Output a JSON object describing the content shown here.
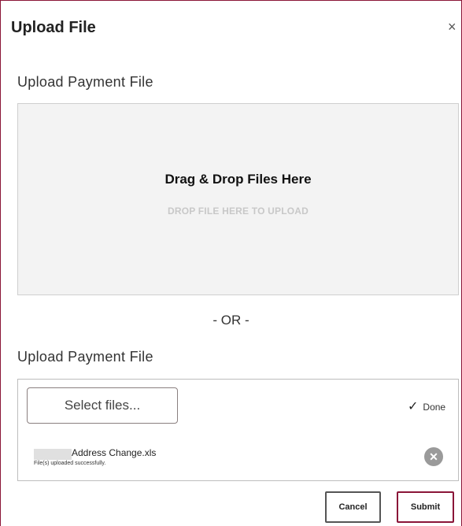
{
  "dialog": {
    "title": "Upload File",
    "close_glyph": "×"
  },
  "dropzone_section": {
    "label": "Upload Payment File",
    "title": "Drag & Drop Files Here",
    "subtitle": "DROP FILE HERE TO UPLOAD"
  },
  "divider": {
    "text": "- OR -"
  },
  "file_section": {
    "label": "Upload Payment File",
    "select_button_label": "Select files...",
    "status_label": "Done",
    "status_icon": "check-icon",
    "file": {
      "name": "Address Change.xls",
      "status": "File(s) uploaded successfully.",
      "remove_icon": "remove-icon"
    }
  },
  "footer": {
    "cancel_label": "Cancel",
    "submit_label": "Submit"
  },
  "colors": {
    "accent": "#8a1538",
    "dropzone_bg": "#f3f3f3",
    "muted_text": "#c8c8c8"
  }
}
